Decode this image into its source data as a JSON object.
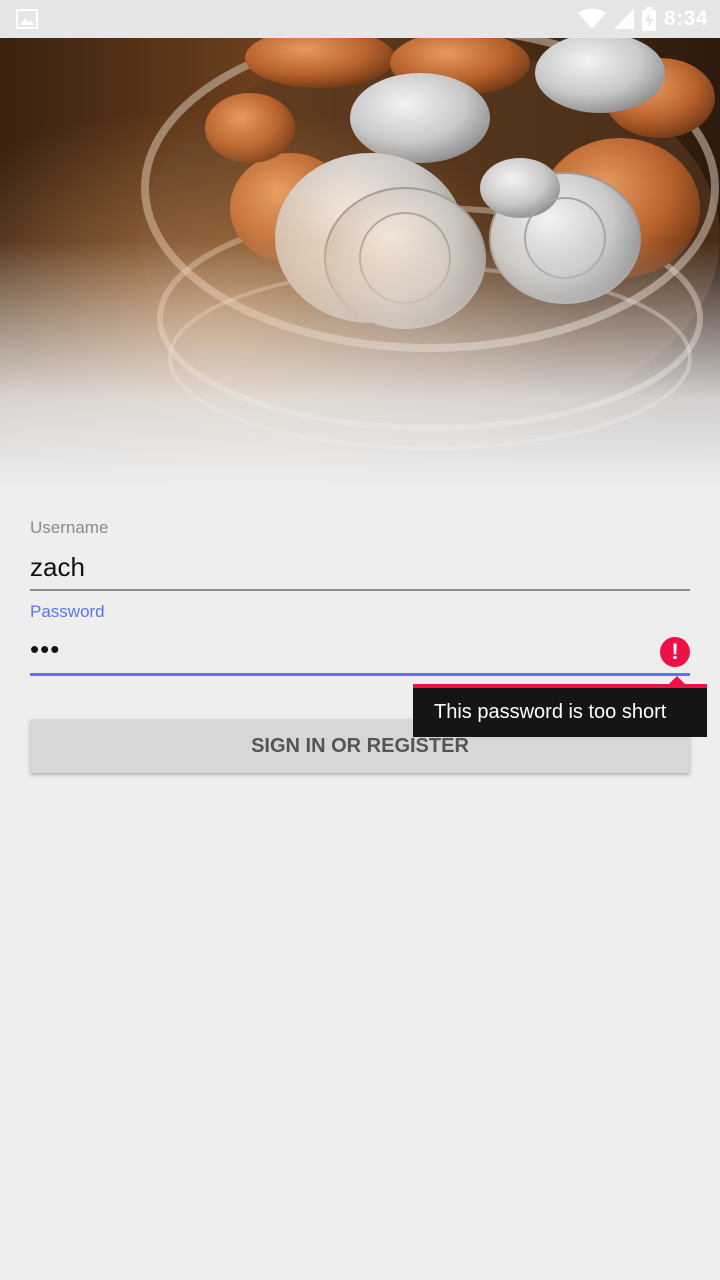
{
  "status_bar": {
    "time": "8:34",
    "icons": [
      "image-notification-icon",
      "wifi-icon",
      "cell-signal-icon",
      "battery-charging-icon"
    ]
  },
  "hero": {
    "image": "coin-jar-photo"
  },
  "form": {
    "username_label": "Username",
    "username_value": "zach",
    "password_label": "Password",
    "password_value": "•••",
    "error_message": "This password is too short",
    "submit_label": "SIGN IN OR REGISTER"
  },
  "colors": {
    "accent": "#5677f0",
    "error": "#ee1144",
    "background": "#eeeeee",
    "button": "#d6d7d7"
  }
}
